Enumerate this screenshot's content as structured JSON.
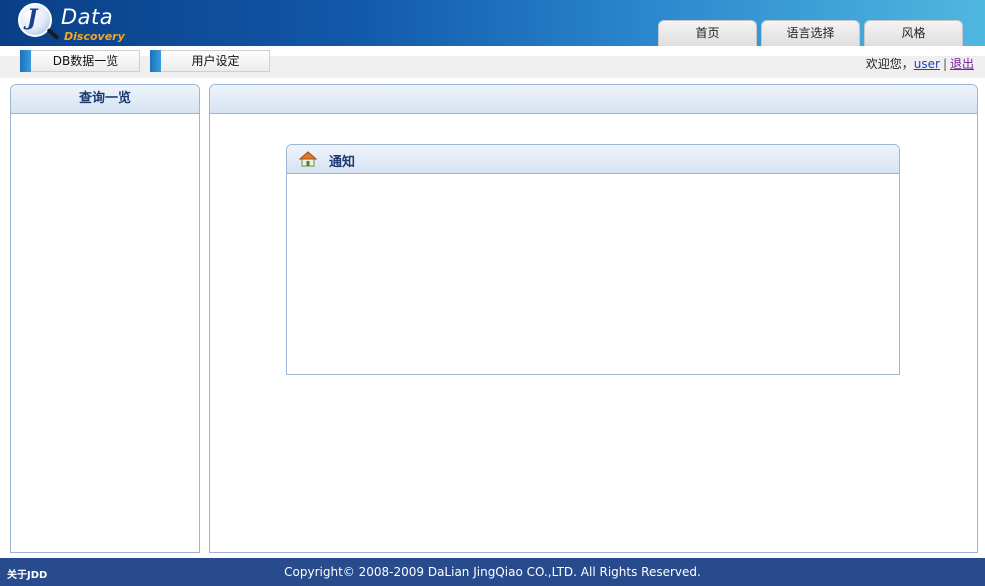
{
  "logo": {
    "letter": "J",
    "word": "Data",
    "sub": "Discovery"
  },
  "top_tabs": [
    {
      "label": "首页"
    },
    {
      "label": "语言选择"
    },
    {
      "label": "风格"
    }
  ],
  "subnav": [
    {
      "label": "DB数据一览"
    },
    {
      "label": "用户设定"
    }
  ],
  "welcome": {
    "prefix": "欢迎您，",
    "user": "user",
    "separator": "|",
    "logout": "退出"
  },
  "left_panel": {
    "title": "查询一览"
  },
  "notice": {
    "title": "通知",
    "icon": "home-icon"
  },
  "footer": {
    "about": "关于JDD",
    "copyright": "Copyright© 2008-2009 DaLian JingQiao CO.,LTD. All Rights Reserved."
  },
  "colors": {
    "header_start": "#0a3f86",
    "header_end": "#4fb8e0",
    "panel_border": "#9db6d2",
    "title_text": "#1d3a73",
    "footer_bg": "#274b8c"
  }
}
